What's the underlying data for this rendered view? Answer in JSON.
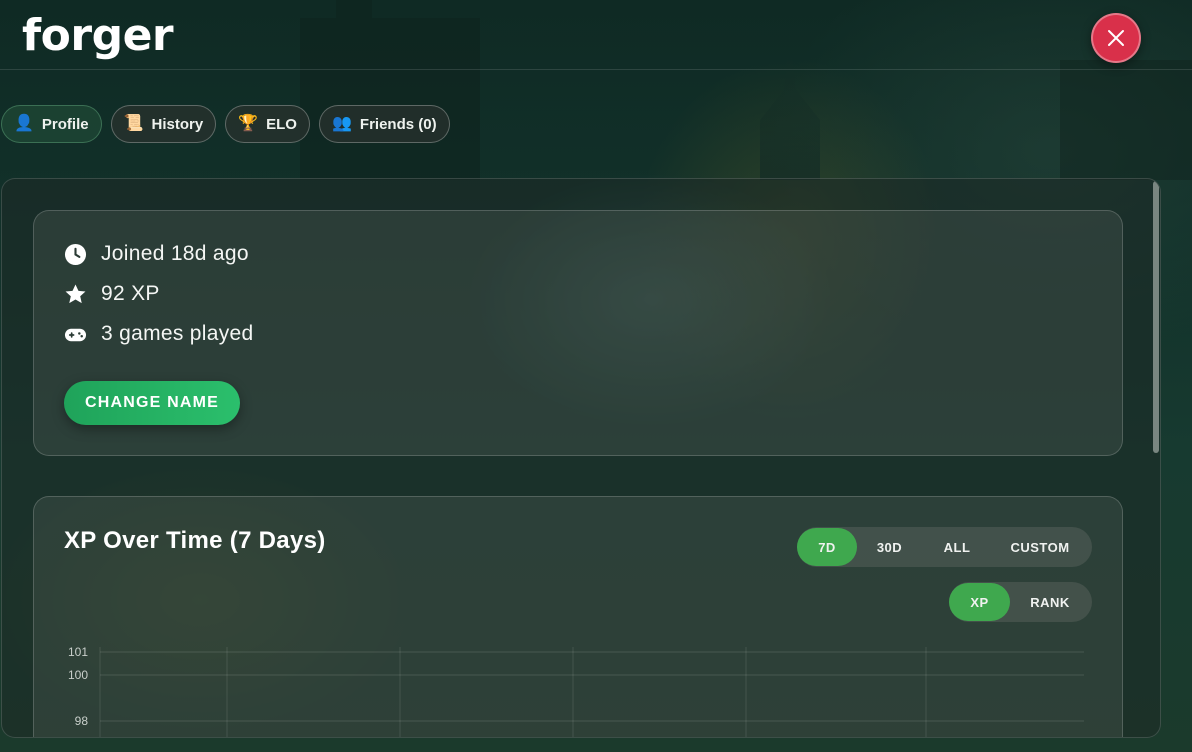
{
  "header": {
    "title": "forger"
  },
  "tabs": [
    {
      "label": "Profile",
      "icon": "👤"
    },
    {
      "label": "History",
      "icon": "📜"
    },
    {
      "label": "ELO",
      "icon": "🏆"
    },
    {
      "label": "Friends (0)",
      "icon": "👥"
    }
  ],
  "profile": {
    "joined": "Joined 18d ago",
    "xp": "92 XP",
    "games": "3 games played",
    "change_name": "CHANGE NAME"
  },
  "chart_card": {
    "title": "XP Over Time (7 Days)",
    "ranges": [
      "7D",
      "30D",
      "ALL",
      "CUSTOM"
    ],
    "active_range": "7D",
    "metrics": [
      "XP",
      "RANK"
    ],
    "active_metric": "XP"
  },
  "chart_data": {
    "type": "line",
    "title": "XP Over Time (7 Days)",
    "y_ticks": [
      101,
      100,
      98
    ],
    "series": [],
    "grid": true
  },
  "colors": {
    "accent_green": "#3fa84e",
    "button_green": "#1fa35a",
    "close_red": "#d9304a"
  }
}
